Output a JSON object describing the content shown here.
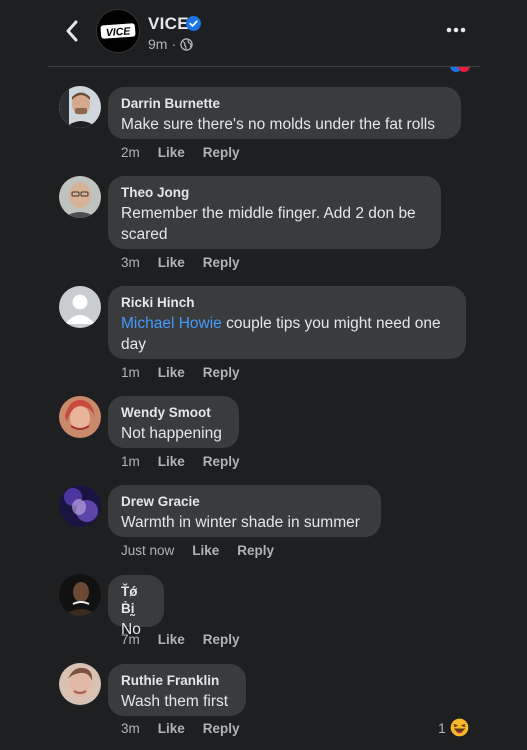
{
  "header": {
    "page_name": "VICE",
    "logo_text": "VICE",
    "post_time": "9m",
    "separator": "·"
  },
  "comments": [
    {
      "author": "Darrin Burnette",
      "text": "Make sure there's no molds under the fat rolls",
      "time": "2m",
      "like": "Like",
      "reply": "Reply"
    },
    {
      "author": "Theo Jong",
      "text": "Remember the middle finger. Add 2 don be scared",
      "time": "3m",
      "like": "Like",
      "reply": "Reply"
    },
    {
      "author": "Ricki Hinch",
      "mention": "Michael Howie",
      "text": " couple tips you might need one day",
      "time": "1m",
      "like": "Like",
      "reply": "Reply"
    },
    {
      "author": "Wendy Smoot",
      "text": "Not happening",
      "time": "1m",
      "like": "Like",
      "reply": "Reply"
    },
    {
      "author": "Drew Gracie",
      "text": "Warmth in winter shade in summer",
      "time": "Just now",
      "like": "Like",
      "reply": "Reply"
    },
    {
      "author": "Ťǿ Ḃḭ",
      "text": "No",
      "time": "7m",
      "like": "Like",
      "reply": "Reply"
    },
    {
      "author": "Ruthie Franklin",
      "text": "Wash them first",
      "time": "3m",
      "like": "Like",
      "reply": "Reply",
      "reaction_count": "1",
      "reaction_icon": "laughing-emoji-icon"
    }
  ],
  "colors": {
    "background": "#1e1f21",
    "bubble": "#3a3b3c",
    "text_primary": "#e4e6eb",
    "text_secondary": "#b0b3b8",
    "mention": "#4599ff",
    "verified": "#1b74e4"
  }
}
